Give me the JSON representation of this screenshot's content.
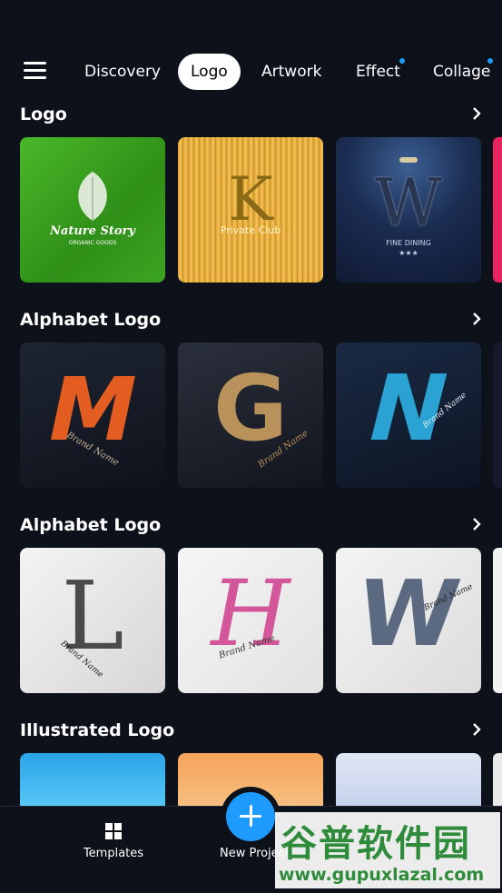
{
  "nav": {
    "tabs": [
      {
        "label": "Discovery",
        "active": false,
        "dot": false
      },
      {
        "label": "Logo",
        "active": true,
        "dot": false
      },
      {
        "label": "Artwork",
        "active": false,
        "dot": false
      },
      {
        "label": "Effect",
        "active": false,
        "dot": true
      },
      {
        "label": "Collage",
        "active": false,
        "dot": true
      }
    ]
  },
  "sections": [
    {
      "title": "Logo",
      "items": [
        {
          "text": "Nature Story",
          "subtext": "ORGANIC GOODS"
        },
        {
          "text": "Private Club",
          "letter": "K"
        },
        {
          "text": "FINE DINING",
          "letter": "W",
          "stars": "★★★"
        }
      ]
    },
    {
      "title": "Alphabet Logo",
      "items": [
        {
          "text": "Brand Name",
          "letter": "M"
        },
        {
          "text": "Brand Name",
          "letter": "G"
        },
        {
          "text": "Brand Name",
          "letter": "N"
        }
      ]
    },
    {
      "title": "Alphabet Logo",
      "items": [
        {
          "text": "Brand Name",
          "letter": "L"
        },
        {
          "text": "Brand Name",
          "letter": "H"
        },
        {
          "text": "Brand Name",
          "letter": "W"
        }
      ]
    },
    {
      "title": "Illustrated Logo",
      "items": [
        {},
        {},
        {}
      ]
    }
  ],
  "bottom_nav": {
    "templates_label": "Templates",
    "new_project_label": "New Project"
  },
  "watermark": {
    "cn_text": "谷普软件园",
    "url": "www.gupuxlazal.com"
  },
  "colors": {
    "background": "#0d111a",
    "accent": "#1e9bff"
  }
}
